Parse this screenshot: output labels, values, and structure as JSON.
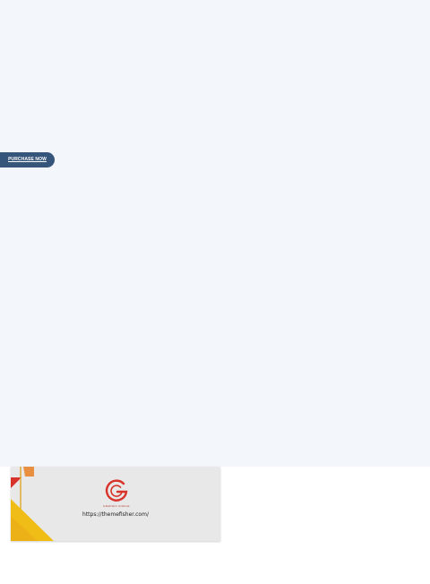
{
  "hero": {
    "purchase_label": "PURCHASE NOW"
  },
  "card": {
    "logo_icon": "graphic-circle-g-logo-icon",
    "logo_tagline": "GRAPHIC CIRCLE",
    "url": "https://themefisher.com/"
  },
  "colors": {
    "hero_background": "#f3f6fb",
    "button": "#35557a",
    "card_background": "#e8e8e8",
    "accent_red": "#d8332b",
    "accent_orange": "#e9852f",
    "accent_yellow": "#f0bd17"
  }
}
